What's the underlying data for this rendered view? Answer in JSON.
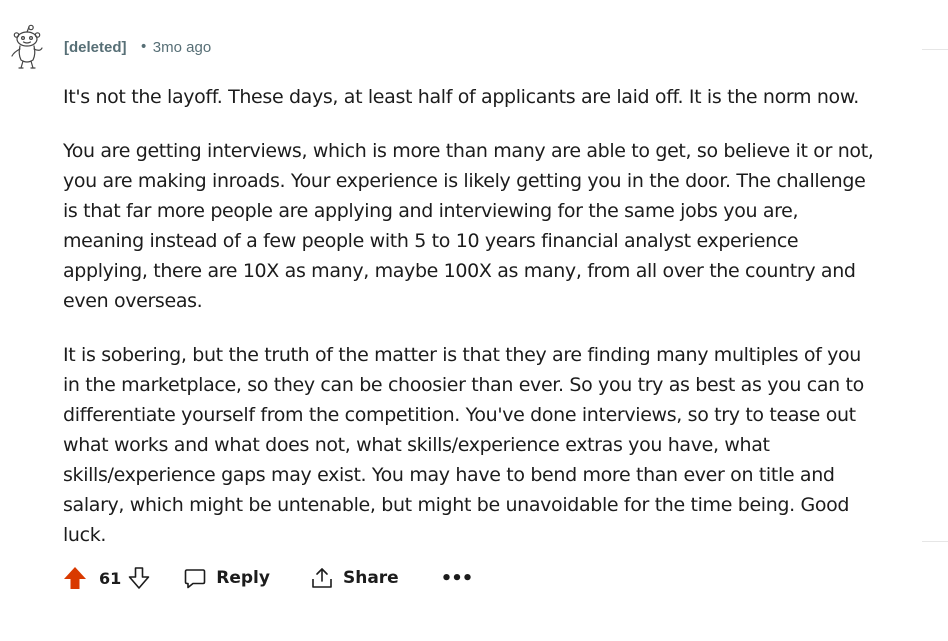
{
  "comment": {
    "author": "[deleted]",
    "separator": "•",
    "timestamp": "3mo ago",
    "avatar_icon": "snoo-deleted-avatar-icon",
    "paragraphs": [
      "It's not the layoff. These days, at least half of applicants are laid off. It is the norm now.",
      "You are getting interviews, which is more than many are able to get, so believe it or not, you are making inroads. Your experience is likely getting you in the door. The challenge is that far more people are applying and interviewing for the same jobs you are, meaning instead of a few people with 5 to 10 years financial analyst experience applying, there are 10X as many, maybe 100X as many, from all over the country and even overseas.",
      "It is sobering, but the truth of the matter is that they are finding many multiples of you in the marketplace, so they can be choosier than ever. So you try as best as you can to differentiate yourself from the competition. You've done interviews, so try to tease out what works and what does not, what skills/experience extras you have, what skills/experience gaps may exist. You may have to bend more than ever on title and salary, which might be untenable, but might be unavoidable for the time being. Good luck."
    ]
  },
  "actions": {
    "score": "61",
    "upvote_icon": "upvote-arrow-icon",
    "downvote_icon": "downvote-arrow-icon",
    "reply_label": "Reply",
    "share_label": "Share",
    "more_label": "•••",
    "upvote_color": "#d93900"
  }
}
